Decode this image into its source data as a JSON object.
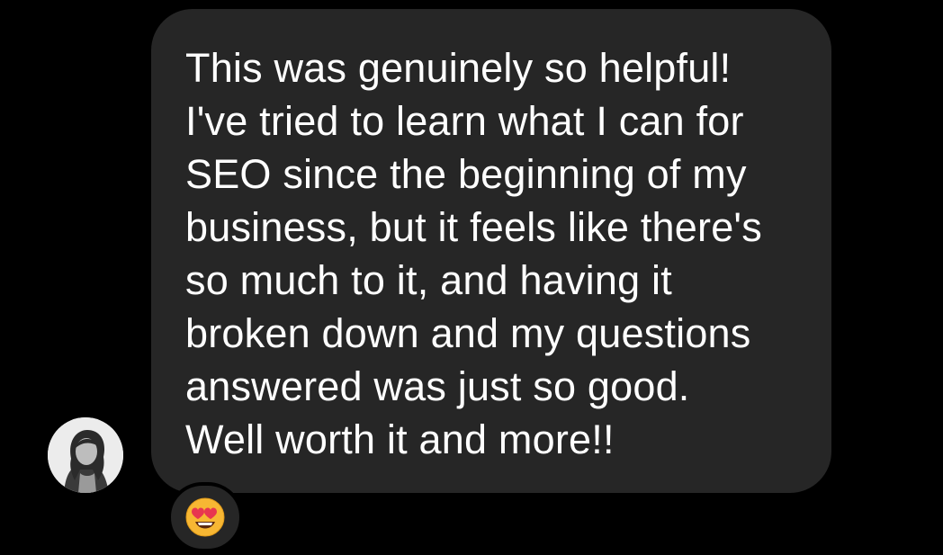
{
  "message": {
    "lines": [
      "This was genuinely so helpful!",
      "I've tried to learn what I can for",
      "SEO since the beginning of my",
      "business, but it feels like there's",
      "so much to it, and having it",
      "broken down and my questions",
      "answered was just so good.",
      "Well worth it and more!!"
    ]
  },
  "reaction": {
    "icon": "heart-eyes-emoji-icon"
  },
  "avatar": {
    "icon": "profile-photo-icon"
  },
  "colors": {
    "background": "#000000",
    "bubble": "#262626",
    "text": "#ffffff",
    "emoji_face": "#f7b733",
    "emoji_hearts": "#e8364f"
  }
}
